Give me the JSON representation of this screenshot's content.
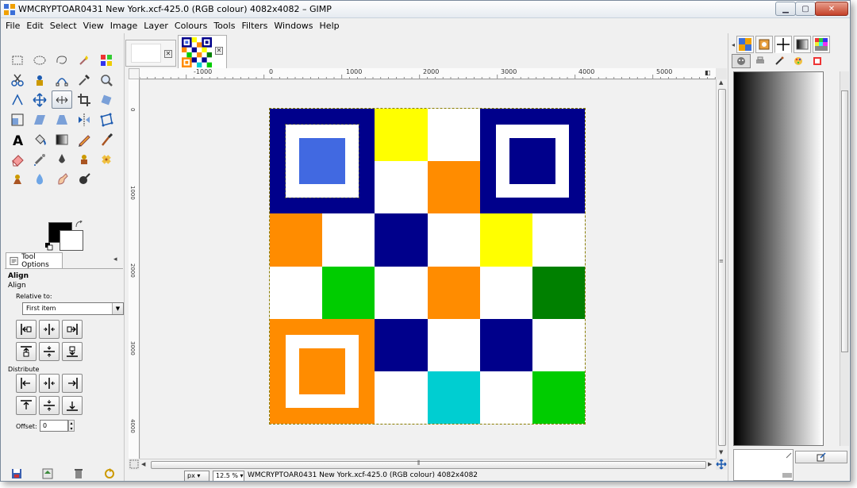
{
  "window": {
    "title": "WMCRYPTOAR0431 New York.xcf-425.0 (RGB colour) 4082x4082 – GIMP",
    "buttons": {
      "minimize": "▁",
      "maximize": "▢",
      "close": "✕"
    }
  },
  "menubar": {
    "items": [
      "File",
      "Edit",
      "Select",
      "View",
      "Image",
      "Layer",
      "Colours",
      "Tools",
      "Filters",
      "Windows",
      "Help"
    ]
  },
  "toolbox": {
    "tools": [
      "rect-select-icon",
      "ellipse-select-icon",
      "free-select-icon",
      "fuzzy-select-icon",
      "select-by-color-icon",
      "scissors-icon",
      "foreground-select-icon",
      "paths-icon",
      "color-picker-icon",
      "zoom-icon",
      "measure-icon",
      "move-icon",
      "align-icon",
      "crop-icon",
      "rotate-icon",
      "scale-icon",
      "shear-icon",
      "perspective-icon",
      "flip-icon",
      "cage-icon",
      "text-icon",
      "bucket-fill-icon",
      "blend-icon",
      "pencil-icon",
      "paintbrush-icon",
      "eraser-icon",
      "airbrush-icon",
      "ink-icon",
      "clone-icon",
      "heal-icon",
      "perspective-clone-icon",
      "blur-icon",
      "smudge-icon",
      "dodge-burn-icon"
    ],
    "active_tool_index": 12
  },
  "tool_options": {
    "tab_label": "Tool Options",
    "title": "Align",
    "subtitle": "Align",
    "relative_to_label": "Relative to:",
    "relative_to_value": "First item",
    "distribute_label": "Distribute",
    "offset_label": "Offset:",
    "offset_value": "0"
  },
  "image_window": {
    "tabs": [
      {
        "name": "blank image"
      },
      {
        "name": "qr image",
        "active": true
      }
    ],
    "ruler_top_labels": [
      "-1000",
      "0",
      "1000",
      "2000",
      "3000",
      "4000",
      "5000"
    ],
    "ruler_left_labels": [
      "0",
      "1000",
      "2000",
      "3000",
      "4000"
    ],
    "unit": "px",
    "zoom": "12.5 %",
    "status": "WMCRYPTOAR0431 New York.xcf-425.0 (RGB colour) 4082x4082"
  },
  "colors": {
    "navy": "#00008b",
    "royal_blue": "#4169e1",
    "yellow": "#ffff00",
    "orange": "#ff8c00",
    "green": "#00cc00",
    "dark_green": "#008000",
    "cyan": "#00ced1",
    "white": "#ffffff"
  },
  "image_grid": [
    [
      "navy-finder",
      "navy-finder",
      "yellow",
      "white",
      "navy-finder",
      "navy-finder"
    ],
    [
      "navy-finder",
      "navy-finder",
      "white",
      "orange",
      "navy-finder",
      "navy-finder"
    ],
    [
      "orange",
      "white",
      "navy",
      "white",
      "yellow",
      "white"
    ],
    [
      "white",
      "green",
      "white",
      "orange",
      "white",
      "dark_green"
    ],
    [
      "orange-finder",
      "orange-finder",
      "navy",
      "white",
      "navy",
      "white"
    ],
    [
      "orange-finder",
      "orange-finder",
      "white",
      "cyan",
      "white",
      "green"
    ]
  ],
  "dock": {
    "tabs": [
      "patterns-icon",
      "brushes-icon",
      "tool-presets-icon",
      "gradients-icon",
      "palettes-icon"
    ],
    "row2": [
      "gimp-icon",
      "printer-icon",
      "brush-icon",
      "palette-icon",
      "fonts-icon"
    ]
  }
}
